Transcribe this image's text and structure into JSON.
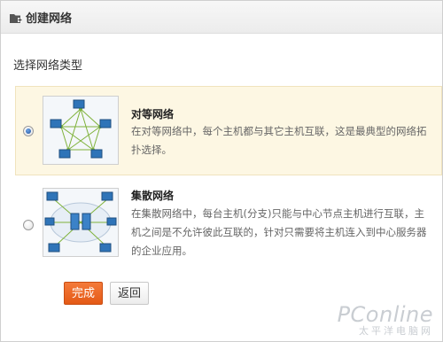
{
  "window": {
    "title": "创建网络"
  },
  "prompt": "选择网络类型",
  "options": [
    {
      "title": "对等网络",
      "desc_line1": "在对等网络中，每个主机都与其它主机互联，这是最典型的网络拓",
      "desc_line2": "扑选择。",
      "selected": true
    },
    {
      "title": "集散网络",
      "desc_line1": "在集散网络中，每台主机(分支)只能与中心节点主机进行互联，主",
      "desc_line2": "机之间是不允许彼此互联的，针对只需要将主机连入到中心服务器",
      "desc_line3": "的企业应用。",
      "selected": false
    }
  ],
  "buttons": {
    "finish": "完成",
    "back": "返回"
  },
  "watermark": {
    "line1": "PConline",
    "line2": "太平洋电脑网"
  },
  "colors": {
    "primary": "#e8611f",
    "selected_bg": "#fdf7e3"
  }
}
